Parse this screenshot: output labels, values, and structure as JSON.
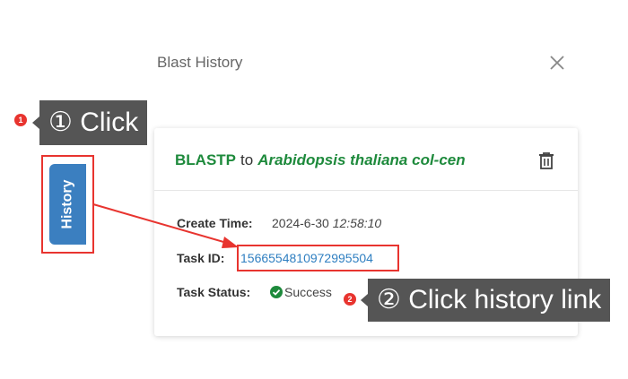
{
  "dialog": {
    "title": "Blast History",
    "close_icon": "close-icon"
  },
  "annotations": {
    "step1": {
      "badge": "1",
      "text": "① Click"
    },
    "step2": {
      "badge": "2",
      "text": "② Click history link"
    },
    "highlight_color": "#e8342f"
  },
  "history_tab": {
    "label": "History",
    "color": "#3b7fc0"
  },
  "task_card": {
    "program": "BLASTP",
    "connector": "to",
    "species": "Arabidopsis thaliana col-cen",
    "delete_icon": "trash-icon",
    "create_time_label": "Create Time:",
    "create_date": "2024-6-30",
    "create_time": "12:58:10",
    "task_id_label": "Task ID:",
    "task_id": "1566554810972995504",
    "task_status_label": "Task Status:",
    "task_status": "Success",
    "status_icon": "check-circle-icon",
    "accent_color": "#1e8a3c",
    "link_color": "#2f7fc1"
  }
}
